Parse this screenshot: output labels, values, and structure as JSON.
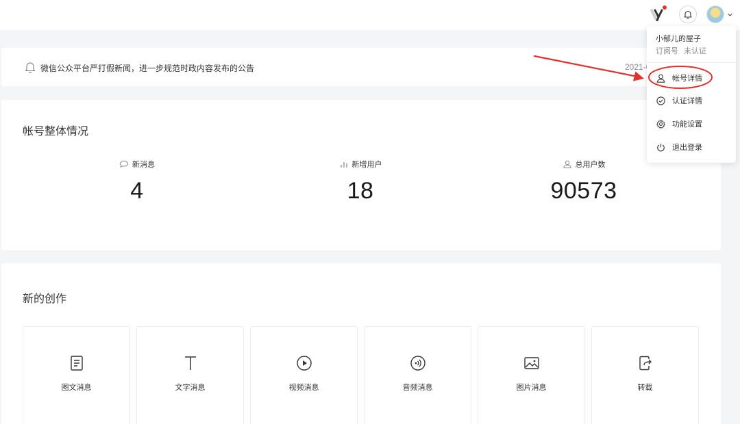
{
  "header": {
    "brand_icon": "y-brand-icon",
    "bell_icon": "bell-icon",
    "avatar": "user-avatar",
    "dropdown_icon": "chevron-down-icon"
  },
  "notice": {
    "icon": "bell-icon",
    "text": "微信公众平台严打假新闻，进一步规范时政内容发布的公告",
    "date": "2021-0"
  },
  "overview": {
    "title": "帐号整体情况",
    "stats": [
      {
        "icon": "chat-bubble-icon",
        "label": "新消息",
        "value": "4"
      },
      {
        "icon": "bar-chart-icon",
        "label": "新增用户",
        "value": "18"
      },
      {
        "icon": "user-icon",
        "label": "总用户数",
        "value": "90573"
      }
    ]
  },
  "create": {
    "title": "新的创作",
    "items": [
      {
        "icon": "document-icon",
        "label": "图文消息"
      },
      {
        "icon": "text-icon",
        "label": "文字消息"
      },
      {
        "icon": "play-icon",
        "label": "视频消息"
      },
      {
        "icon": "audio-icon",
        "label": "音频消息"
      },
      {
        "icon": "image-icon",
        "label": "图片消息"
      },
      {
        "icon": "share-icon",
        "label": "转载"
      }
    ]
  },
  "account_menu": {
    "name": "小郁儿的屋子",
    "type": "订阅号",
    "status": "未认证",
    "items": [
      {
        "icon": "user-icon",
        "label": "帐号详情"
      },
      {
        "icon": "check-circle-icon",
        "label": "认证详情"
      },
      {
        "icon": "gear-icon",
        "label": "功能设置"
      },
      {
        "icon": "power-icon",
        "label": "退出登录"
      }
    ]
  },
  "colors": {
    "background": "#f4f5f7",
    "card": "#ffffff",
    "annotation": "#e0322f",
    "text": "#353535",
    "muted": "#8a8a8a"
  }
}
